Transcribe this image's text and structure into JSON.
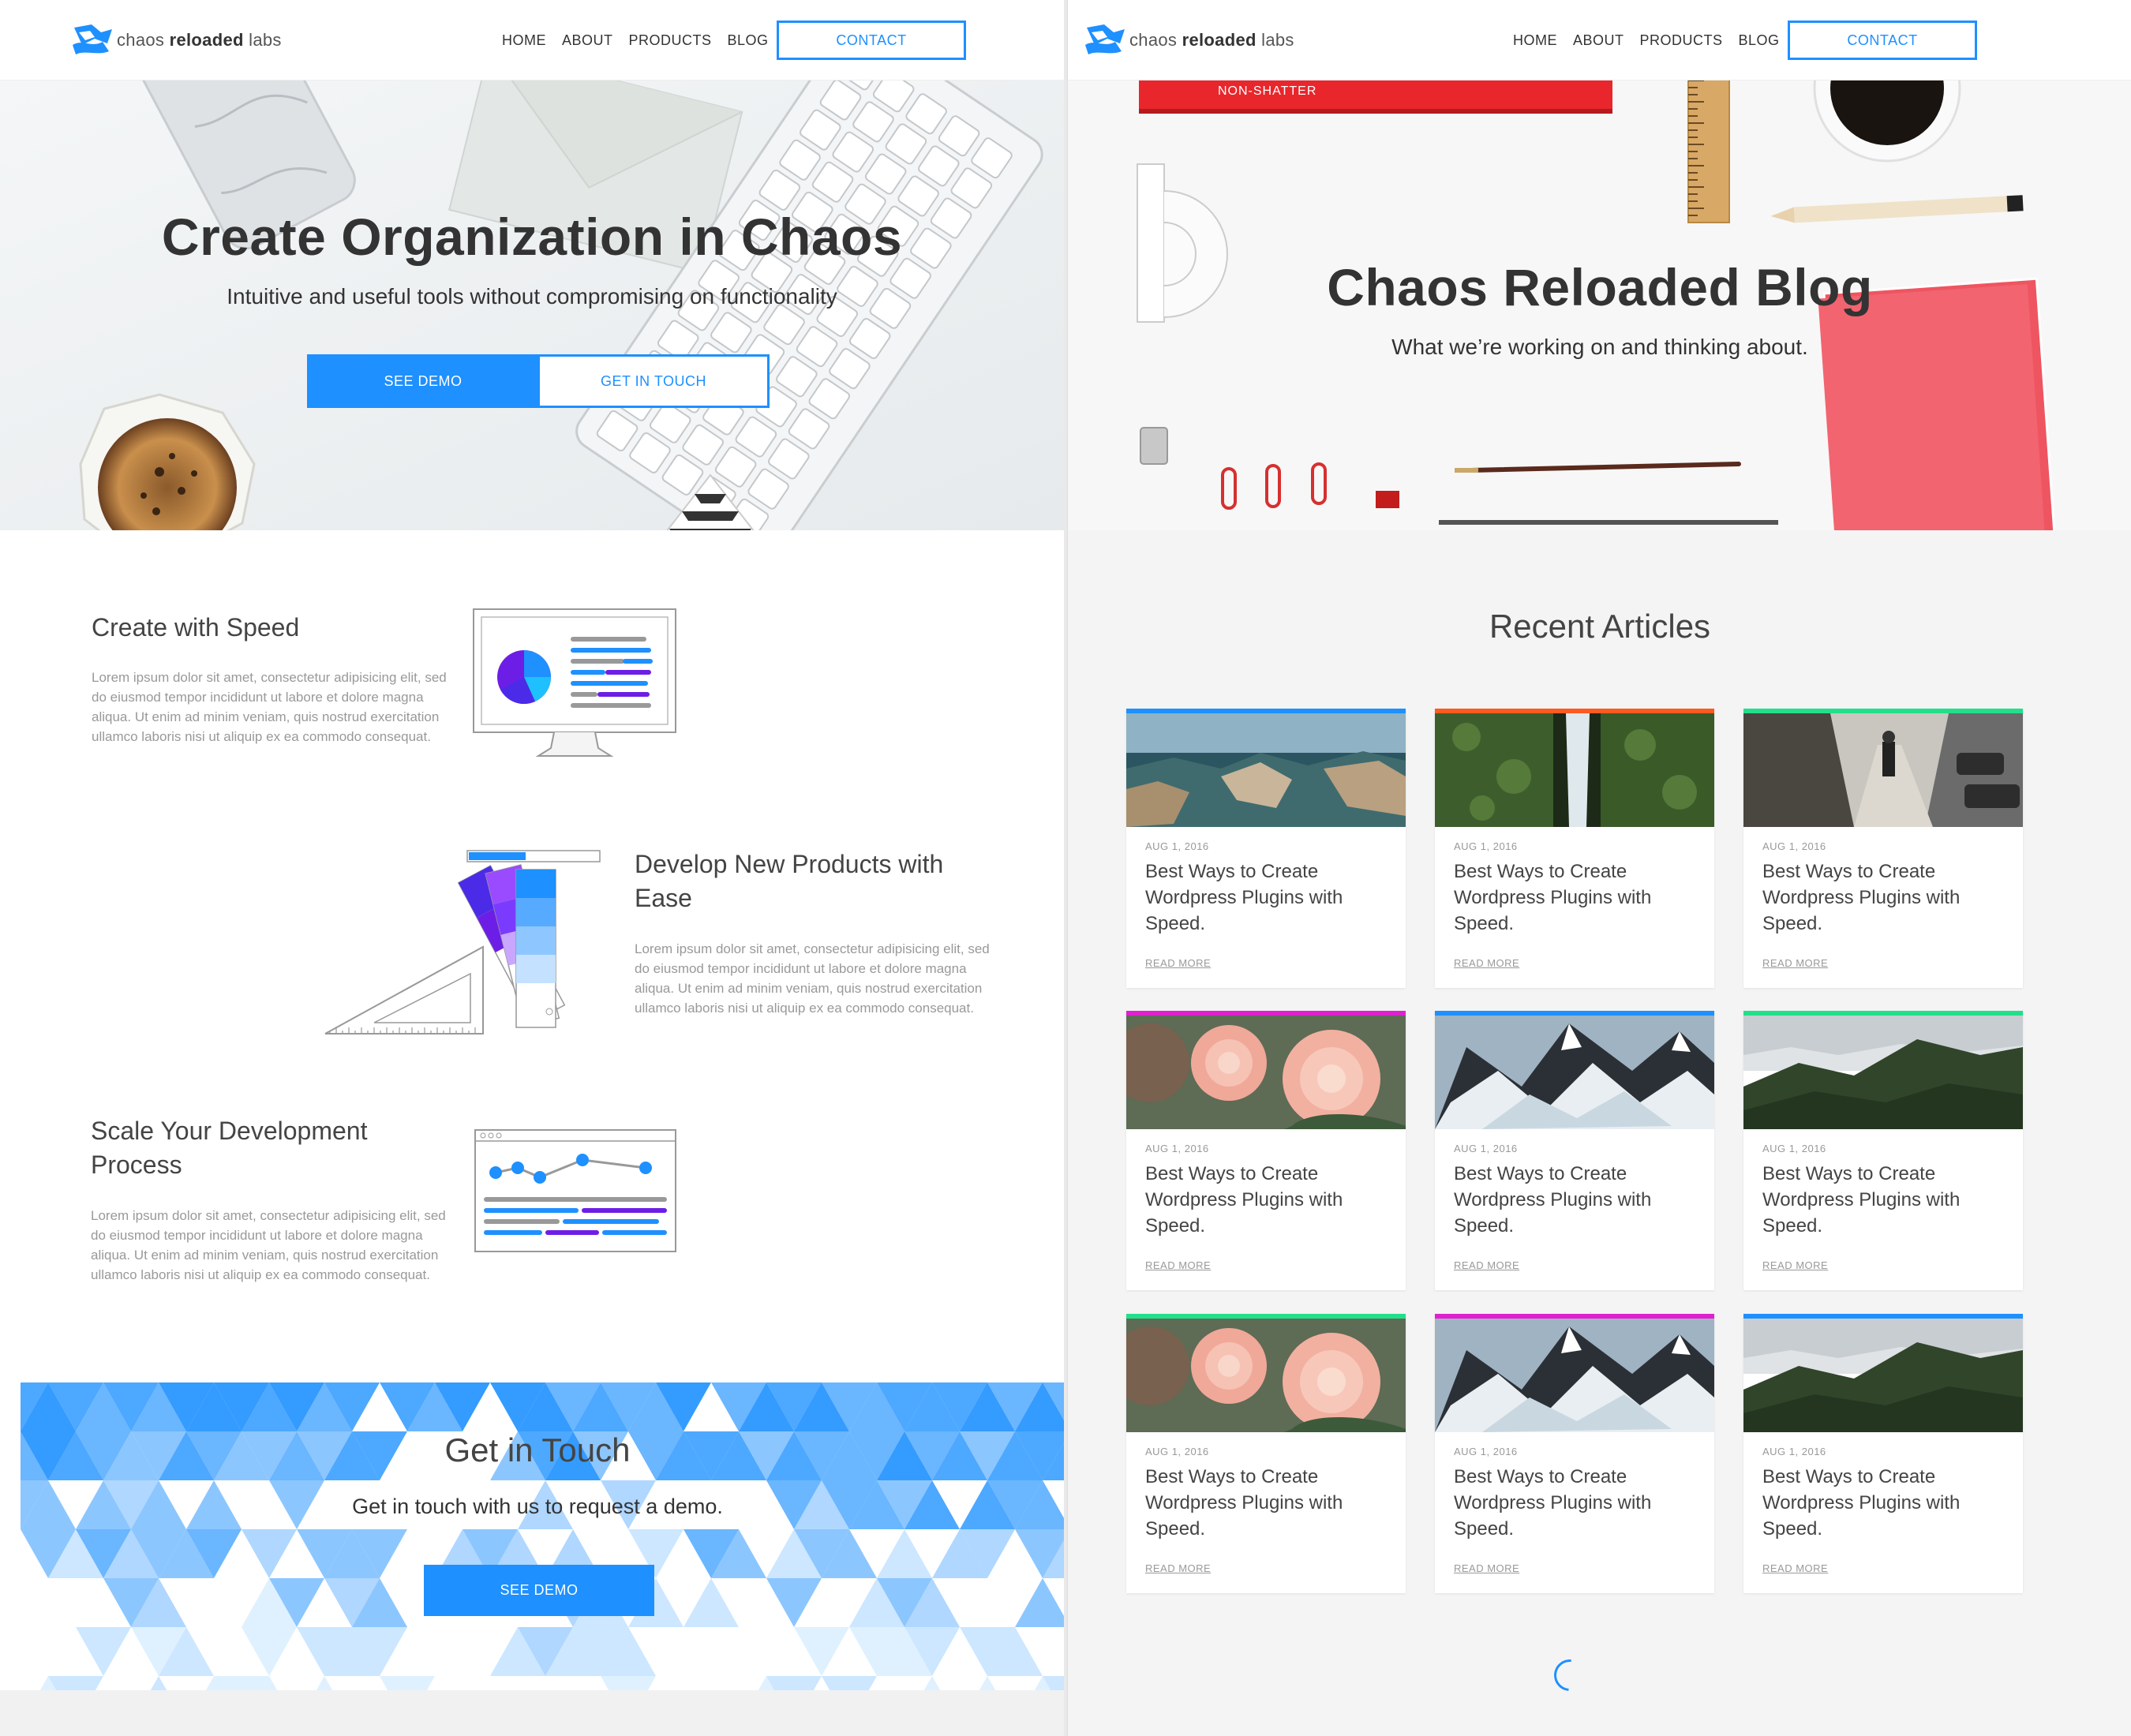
{
  "brand": {
    "name_pre": "chaos ",
    "name_bold": "reloaded",
    "name_post": " labs"
  },
  "nav": {
    "items": [
      "HOME",
      "ABOUT",
      "PRODUCTS",
      "BLOG"
    ],
    "contact": "CONTACT"
  },
  "home": {
    "hero": {
      "title": "Create Organization in Chaos",
      "subtitle": "Intuitive and useful tools without compromising on functionality",
      "primary_button": "SEE DEMO",
      "secondary_button": "GET IN TOUCH"
    },
    "features": [
      {
        "title": "Create with Speed",
        "text": "Lorem ipsum dolor sit amet, consectetur adipisicing elit, sed do eiusmod tempor incididunt ut labore et dolore magna aliqua. Ut enim ad minim veniam, quis nostrud exercitation ullamco laboris nisi ut aliquip ex ea commodo consequat."
      },
      {
        "title": "Develop New Products with Ease",
        "text": "Lorem ipsum dolor sit amet, consectetur adipisicing elit, sed do eiusmod tempor incididunt ut labore et dolore magna aliqua. Ut enim ad minim veniam, quis nostrud exercitation ullamco laboris nisi ut aliquip ex ea commodo consequat."
      },
      {
        "title": "Scale Your Development Process",
        "text": "Lorem ipsum dolor sit amet, consectetur adipisicing elit, sed do eiusmod tempor incididunt ut labore et dolore magna aliqua. Ut enim ad minim veniam, quis nostrud exercitation ullamco laboris nisi ut aliquip ex ea commodo consequat."
      }
    ],
    "touch": {
      "title": "Get in Touch",
      "subtitle": "Get in touch with us to request a demo.",
      "button": "SEE DEMO"
    },
    "ruler_text": "NON-SHATTER"
  },
  "blog": {
    "hero": {
      "title": "Chaos Reloaded Blog",
      "subtitle": "What we’re working on and thinking about."
    },
    "section_title": "Recent Articles",
    "articles": [
      {
        "date": "AUG 1, 2016",
        "title": "Best Ways to Create Wordpress Plugins with Speed.",
        "read_more": "READ MORE",
        "accent": "#1e90ff",
        "image": "coast-cliffs"
      },
      {
        "date": "AUG 1, 2016",
        "title": "Best Ways to Create Wordpress Plugins with Speed.",
        "read_more": "READ MORE",
        "accent": "#ff5a1f",
        "image": "waterfall-ivy"
      },
      {
        "date": "AUG 1, 2016",
        "title": "Best Ways to Create Wordpress Plugins with Speed.",
        "read_more": "READ MORE",
        "accent": "#22e08a",
        "image": "street-walker"
      },
      {
        "date": "AUG 1, 2016",
        "title": "Best Ways to Create Wordpress Plugins with Speed.",
        "read_more": "READ MORE",
        "accent": "#e020d0",
        "image": "pink-roses"
      },
      {
        "date": "AUG 1, 2016",
        "title": "Best Ways to Create Wordpress Plugins with Speed.",
        "read_more": "READ MORE",
        "accent": "#1e90ff",
        "image": "glacier-mountain"
      },
      {
        "date": "AUG 1, 2016",
        "title": "Best Ways to Create Wordpress Plugins with Speed.",
        "read_more": "READ MORE",
        "accent": "#22e08a",
        "image": "forest-hills"
      },
      {
        "date": "AUG 1, 2016",
        "title": "Best Ways to Create Wordpress Plugins with Speed.",
        "read_more": "READ MORE",
        "accent": "#22e08a",
        "image": "pink-roses"
      },
      {
        "date": "AUG 1, 2016",
        "title": "Best Ways to Create Wordpress Plugins with Speed.",
        "read_more": "READ MORE",
        "accent": "#e020d0",
        "image": "glacier-mountain"
      },
      {
        "date": "AUG 1, 2016",
        "title": "Best Ways to Create Wordpress Plugins with Speed.",
        "read_more": "READ MORE",
        "accent": "#1e90ff",
        "image": "forest-hills"
      }
    ]
  },
  "colors": {
    "accent": "#1e90ff",
    "text": "#333333",
    "muted": "#999999"
  }
}
